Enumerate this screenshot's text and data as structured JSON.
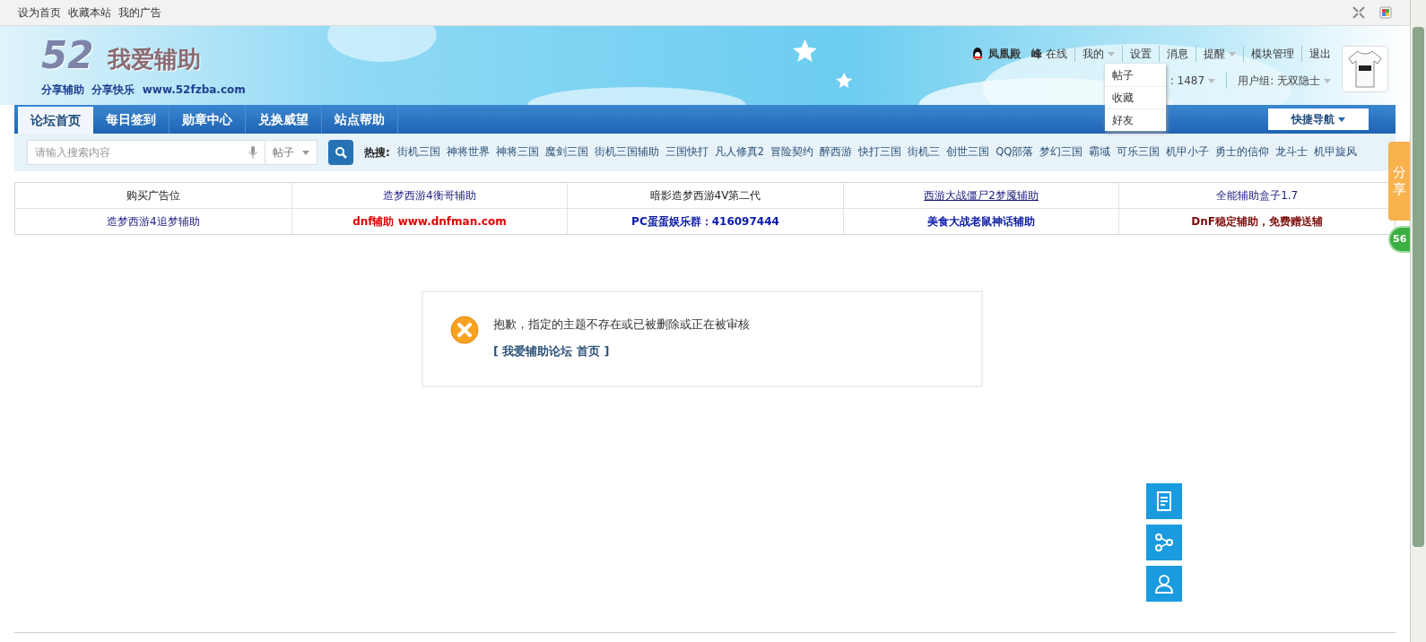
{
  "top_bar": {
    "links": [
      "设为首页",
      "收藏本站",
      "我的广告"
    ]
  },
  "logo": {
    "number": "52",
    "name": "我爱辅助",
    "slogan": "分享辅助  分享快乐  www.52fzba.com"
  },
  "user_bar": {
    "username": "凤凰殿",
    "online_mark": "峰",
    "online": "在线",
    "menu": [
      {
        "label": "我的",
        "caret": true
      },
      {
        "label": "设置",
        "caret": false
      },
      {
        "label": "消息",
        "caret": false
      },
      {
        "label": "提醒",
        "caret": true
      },
      {
        "label": "模块管理",
        "caret": false
      },
      {
        "label": "退出",
        "caret": false
      }
    ],
    "stats": [
      {
        "label": ": 1487"
      },
      {
        "label": "用户组: 无双隐士"
      }
    ],
    "dropdown": [
      "帖子",
      "收藏",
      "好友"
    ]
  },
  "nav": {
    "tabs": [
      {
        "label": "论坛首页",
        "selected": true
      },
      {
        "label": "每日签到",
        "selected": false
      },
      {
        "label": "勋章中心",
        "selected": false
      },
      {
        "label": "兑换威望",
        "selected": false
      },
      {
        "label": "站点帮助",
        "selected": false
      }
    ],
    "quick_nav": "快捷导航"
  },
  "search": {
    "placeholder": "请输入搜索内容",
    "scope": "帖子",
    "hot_label": "热搜:",
    "hot": [
      "街机三国",
      "神将世界",
      "神将三国",
      "魔剑三国",
      "街机三国辅助",
      "三国快打",
      "凡人修真2",
      "冒险契约",
      "醉西游",
      "快打三国",
      "街机三",
      "创世三国",
      "QQ部落",
      "梦幻三国",
      "霸域",
      "可乐三国",
      "机甲小子",
      "勇士的信仰",
      "龙斗士",
      "机甲旋风"
    ]
  },
  "ad_table": {
    "rows": [
      [
        {
          "text": "购买广告位",
          "kind": "plain"
        },
        {
          "text": "造梦西游4衡哥辅助",
          "kind": "link"
        },
        {
          "text": "暗影造梦西游4V第二代",
          "kind": "plain"
        },
        {
          "text": "西游大战僵尸2梦魇辅助",
          "kind": "underlined"
        },
        {
          "text": "全能辅助盒子1.7",
          "kind": "link"
        }
      ],
      [
        {
          "text": "造梦西游4追梦辅助",
          "kind": "link"
        },
        {
          "text": "dnf辅助 www.dnfman.com",
          "kind": "red"
        },
        {
          "text": "PC蛋蛋娱乐群：416097444",
          "kind": "blue"
        },
        {
          "text": "美食大战老鼠神话辅助",
          "kind": "blue"
        },
        {
          "text": "DnF稳定辅助，免费赠送辅",
          "kind": "maroon"
        }
      ]
    ]
  },
  "message": {
    "text": "抱歉，指定的主题不存在或已被删除或正在被审核",
    "link": "[ 我爱辅助论坛 首页 ]"
  },
  "share_tab": "分享",
  "badge": "56"
}
